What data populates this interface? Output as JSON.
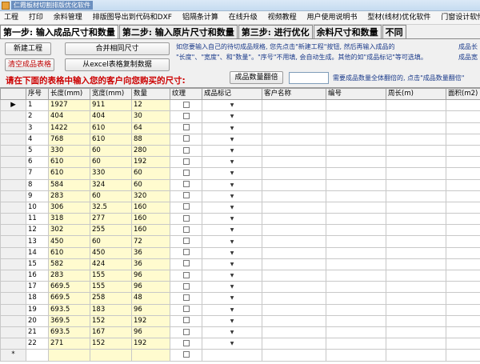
{
  "window": {
    "title": "仁霞板材切割排版优化软件"
  },
  "menu": [
    "工程",
    "打印",
    "余料管理",
    "排版图导出到代码和DXF",
    "铝隔条计算",
    "在线升级",
    "视频教程",
    "用户使用说明书",
    "型材(线材)优化软件",
    "门窗设计软件"
  ],
  "tabs": [
    "第一步: 输入成品尺寸和数量",
    "第二步: 输入原片尺寸和数量",
    "第三步: 进行优化",
    "余料尺寸和数量",
    "不同"
  ],
  "buttons": {
    "new_project": "新建工程",
    "merge_same": "合并相同尺寸",
    "clear_table": "清空成品表格",
    "copy_excel": "从excel表格复制数据",
    "multiply": "成品数量翻倍"
  },
  "info": {
    "line1": "如您要输入自己的待切成品规格, 您先点击\"新建工程\"按钮, 然后再输入成品的",
    "line2": "\"长度\"、\"宽度\"、和\"数量\"。\"序号\"不用填, 会自动生成。其他的如\"成品标记\"等可选填。",
    "right1": "成品长",
    "right2": "成品宽"
  },
  "prompt": "请在下面的表格中输入您的客户向您购买的尺寸:",
  "multiply_hint": "需要成品数量全体翻倍的, 点击\"成品数量翻倍\"",
  "multiply_value": "",
  "columns": [
    "序号",
    "长度(mm)",
    "宽度(mm)",
    "数量",
    "纹理",
    "成品标记",
    "客户名称",
    "编号",
    "周长(m)",
    "面积(m2)"
  ],
  "rows": [
    [
      "1",
      "1927",
      "911",
      "12"
    ],
    [
      "2",
      "404",
      "404",
      "30"
    ],
    [
      "3",
      "1422",
      "610",
      "64"
    ],
    [
      "4",
      "768",
      "610",
      "88"
    ],
    [
      "5",
      "330",
      "60",
      "280"
    ],
    [
      "6",
      "610",
      "60",
      "192"
    ],
    [
      "7",
      "610",
      "330",
      "60"
    ],
    [
      "8",
      "584",
      "324",
      "60"
    ],
    [
      "9",
      "283",
      "60",
      "320"
    ],
    [
      "10",
      "306",
      "32.5",
      "160"
    ],
    [
      "11",
      "318",
      "277",
      "160"
    ],
    [
      "12",
      "302",
      "255",
      "160"
    ],
    [
      "13",
      "450",
      "60",
      "72"
    ],
    [
      "14",
      "610",
      "450",
      "36"
    ],
    [
      "15",
      "582",
      "424",
      "36"
    ],
    [
      "16",
      "283",
      "155",
      "96"
    ],
    [
      "17",
      "669.5",
      "155",
      "96"
    ],
    [
      "18",
      "669.5",
      "258",
      "48"
    ],
    [
      "19",
      "693.5",
      "183",
      "96"
    ],
    [
      "20",
      "369.5",
      "152",
      "192"
    ],
    [
      "21",
      "693.5",
      "167",
      "96"
    ],
    [
      "22",
      "271",
      "152",
      "192"
    ]
  ],
  "row_header_current": "▶",
  "row_header_new": "*",
  "dropdown_glyph": "▼"
}
